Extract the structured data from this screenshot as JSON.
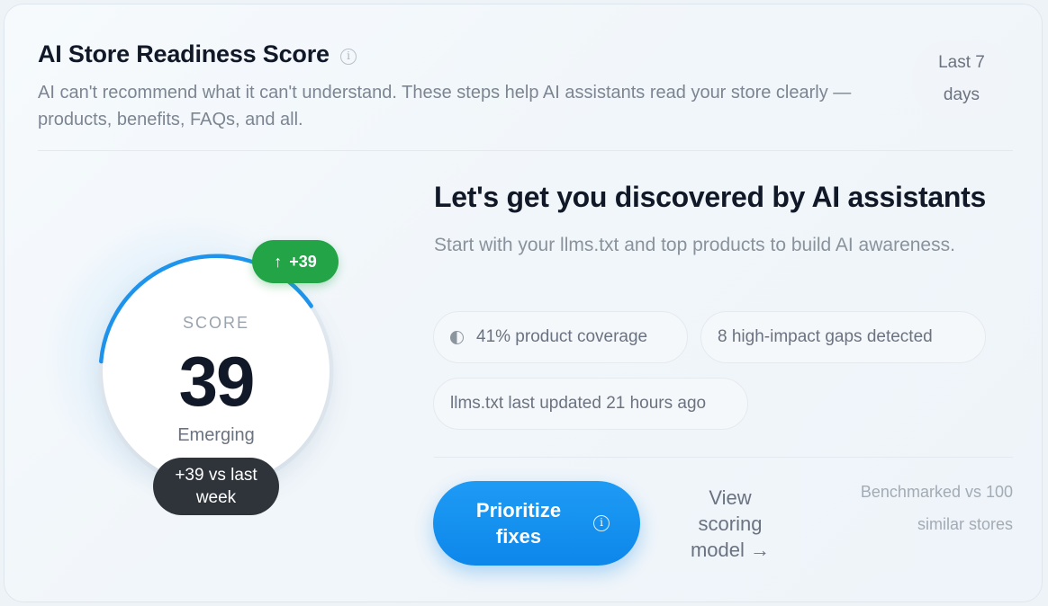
{
  "header": {
    "title": "AI Store Readiness Score",
    "subtitle": "AI can't recommend what it can't understand. These steps help AI assistants read your store clearly — products, benefits, FAQs, and all.",
    "period_label": "Last 7 days"
  },
  "score": {
    "label": "SCORE",
    "value": "39",
    "progress": 0.39,
    "status": "Emerging",
    "delta_label": "+39",
    "week_change": "+39 vs last week"
  },
  "main": {
    "headline": "Let's get you discovered by AI assistants",
    "description": "Start with your llms.txt and top products to build AI awareness.",
    "pills": {
      "coverage": "41% product coverage",
      "gaps": "8 high-impact gaps detected",
      "llms": "llms.txt last updated 21 hours ago"
    },
    "cta_label": "Prioritize fixes",
    "scoring_link": "View scoring model →",
    "benchmark": "Benchmarked vs 100 similar stores"
  },
  "colors": {
    "accent": "#0d87ea",
    "success": "#22a447",
    "dark_badge": "#2f343b"
  },
  "icons": {
    "info": "info-icon",
    "delta": "arrow-up-icon",
    "coverage": "half-circle-icon"
  }
}
